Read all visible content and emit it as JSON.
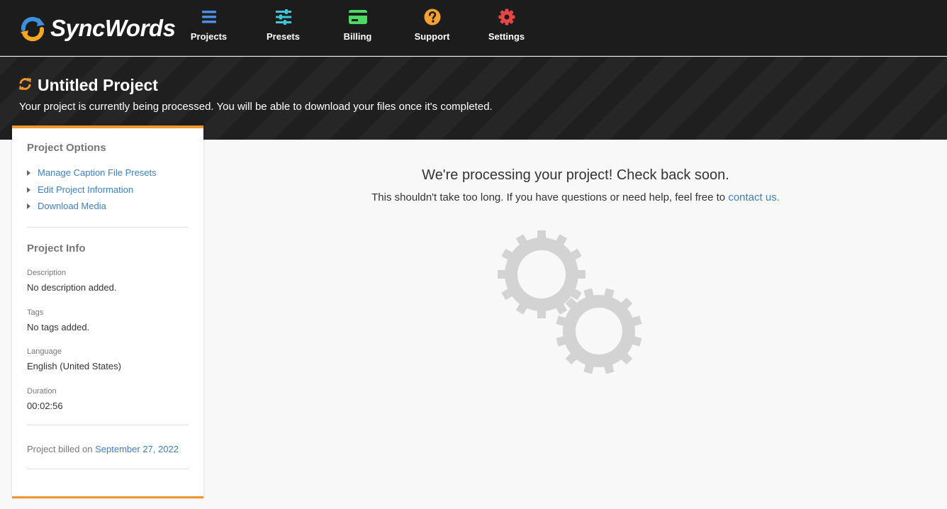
{
  "app": {
    "name": "SyncWords"
  },
  "nav": {
    "items": [
      {
        "label": "Projects",
        "icon": "list-icon",
        "color": "#4a90e2"
      },
      {
        "label": "Presets",
        "icon": "sliders-icon",
        "color": "#3ec6d9"
      },
      {
        "label": "Billing",
        "icon": "credit-card-icon",
        "color": "#4cd964"
      },
      {
        "label": "Support",
        "icon": "question-icon",
        "color": "#f5a033"
      },
      {
        "label": "Settings",
        "icon": "gear-icon",
        "color": "#e84545"
      }
    ]
  },
  "project": {
    "title": "Untitled Project",
    "status_message": "Your project is currently being processed. You will be able to download your files once it's completed."
  },
  "sidebar": {
    "options_heading": "Project Options",
    "options": [
      "Manage Caption File Presets",
      "Edit Project Information",
      "Download Media"
    ],
    "info_heading": "Project Info",
    "info": {
      "description_label": "Description",
      "description_value": "No description added.",
      "tags_label": "Tags",
      "tags_value": "No tags added.",
      "language_label": "Language",
      "language_value": "English (United States)",
      "duration_label": "Duration",
      "duration_value": "00:02:56"
    },
    "billed_prefix": "Project billed on",
    "billed_date": "September 27, 2022"
  },
  "main": {
    "heading": "We're processing your project! Check back soon.",
    "sub_text": "This shouldn't take too long. If you have questions or need help, feel free to",
    "contact_link": "contact us."
  },
  "colors": {
    "accent_orange": "#f0962e",
    "link_blue": "#3d7fc1",
    "gear_gray": "#d3d3d3"
  }
}
